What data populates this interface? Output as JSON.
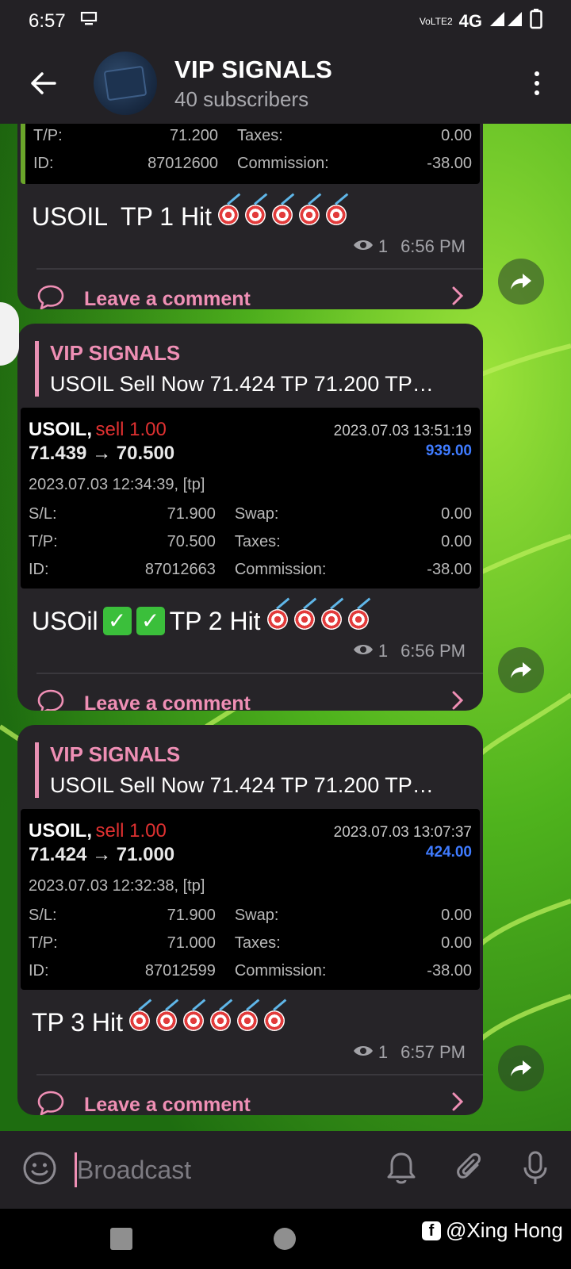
{
  "status_bar": {
    "time": "6:57",
    "network": "4G",
    "lte_label": "VoLTE2"
  },
  "header": {
    "title": "VIP SIGNALS",
    "subtitle": "40 subscribers"
  },
  "messages": [
    {
      "partial_table": {
        "tp_label": "T/P:",
        "tp_value": "71.200",
        "taxes_label": "Taxes:",
        "taxes_value": "0.00",
        "id_label": "ID:",
        "id_value": "87012600",
        "commission_label": "Commission:",
        "commission_value": "-38.00"
      },
      "text": "USOIL  TP 1 Hit",
      "views": "1",
      "time": "6:56 PM",
      "comment_label": "Leave a comment",
      "emoji_count": 5
    },
    {
      "reply_name": "VIP SIGNALS",
      "reply_text": "USOIL Sell Now 71.424 TP 71.200 TP…",
      "trade": {
        "symbol": "USOIL,",
        "side": "sell 1.00",
        "close_time": "2023.07.03 13:51:19",
        "prices": "71.439 → 70.500",
        "profit": "939.00",
        "open_time": "2023.07.03 12:34:39, [tp]",
        "sl_label": "S/L:",
        "sl": "71.900",
        "swap_label": "Swap:",
        "swap": "0.00",
        "tp_label": "T/P:",
        "tp": "70.500",
        "taxes_label": "Taxes:",
        "taxes": "0.00",
        "id_label": "ID:",
        "id": "87012663",
        "commission_label": "Commission:",
        "commission": "-38.00"
      },
      "text_a": "USOil",
      "text_b": "TP 2 Hit",
      "views": "1",
      "time": "6:56 PM",
      "comment_label": "Leave a comment",
      "emoji_count": 4
    },
    {
      "reply_name": "VIP SIGNALS",
      "reply_text": "USOIL Sell Now 71.424 TP 71.200 TP…",
      "trade": {
        "symbol": "USOIL,",
        "side": "sell 1.00",
        "close_time": "2023.07.03 13:07:37",
        "prices": "71.424 → 71.000",
        "profit": "424.00",
        "open_time": "2023.07.03 12:32:38, [tp]",
        "sl_label": "S/L:",
        "sl": "71.900",
        "swap_label": "Swap:",
        "swap": "0.00",
        "tp_label": "T/P:",
        "tp": "71.000",
        "taxes_label": "Taxes:",
        "taxes": "0.00",
        "id_label": "ID:",
        "id": "87012599",
        "commission_label": "Commission:",
        "commission": "-38.00"
      },
      "text": "TP 3 Hit",
      "views": "1",
      "time": "6:57 PM",
      "comment_label": "Leave a comment",
      "emoji_count": 6
    }
  ],
  "composer": {
    "placeholder": "Broadcast"
  },
  "watermark": "@Xing Hong",
  "colors": {
    "accent": "#ef8fb5",
    "bubble": "#262428",
    "bar": "#232125",
    "profit": "#3f7bff",
    "sell": "#e03131"
  }
}
